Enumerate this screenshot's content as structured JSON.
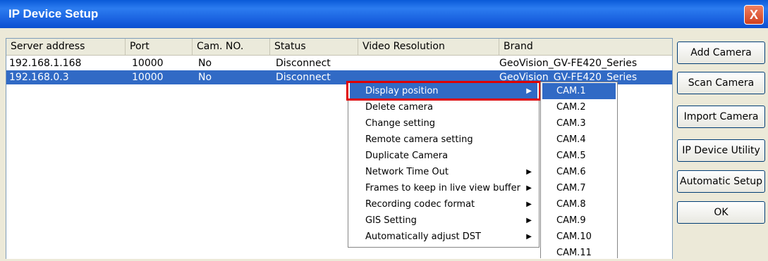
{
  "window": {
    "title": "IP Device Setup",
    "close_label": "X"
  },
  "columns": [
    "Server address",
    "Port",
    "Cam. NO.",
    "Status",
    "Video Resolution",
    "Brand"
  ],
  "rows": [
    {
      "server": "192.168.1.168",
      "port": "10000",
      "cam": "No",
      "status": "Disconnect",
      "resolution": "",
      "brand": "GeoVision_GV-FE420_Series"
    },
    {
      "server": "192.168.0.3",
      "port": "10000",
      "cam": "No",
      "status": "Disconnect",
      "resolution": "",
      "brand": "GeoVision_GV-FE420_Series"
    }
  ],
  "buttons": {
    "add_camera": "Add Camera",
    "scan_camera": "Scan Camera",
    "import_camera": "Import Camera",
    "ip_device_utility": "IP Device Utility",
    "automatic_setup": "Automatic Setup",
    "ok": "OK"
  },
  "context_menu": [
    {
      "label": "Display position",
      "submenu": true
    },
    {
      "label": "Delete camera",
      "submenu": false
    },
    {
      "label": "Change setting",
      "submenu": false
    },
    {
      "label": "Remote camera setting",
      "submenu": false
    },
    {
      "label": "Duplicate Camera",
      "submenu": false
    },
    {
      "label": "Network Time Out",
      "submenu": true
    },
    {
      "label": "Frames to keep in live view buffer",
      "submenu": true
    },
    {
      "label": "Recording codec format",
      "submenu": true
    },
    {
      "label": "GIS Setting",
      "submenu": true
    },
    {
      "label": "Automatically adjust DST",
      "submenu": true
    }
  ],
  "submenu": [
    "CAM.1",
    "CAM.2",
    "CAM.3",
    "CAM.4",
    "CAM.5",
    "CAM.6",
    "CAM.7",
    "CAM.8",
    "CAM.9",
    "CAM.10",
    "CAM.11"
  ],
  "icons": {
    "submenu_arrow": "triangle-right-icon",
    "close": "close-icon"
  },
  "colors": {
    "titlebar": "#0a5ad8",
    "selection": "#316ac5",
    "highlight_box": "#e00000"
  }
}
